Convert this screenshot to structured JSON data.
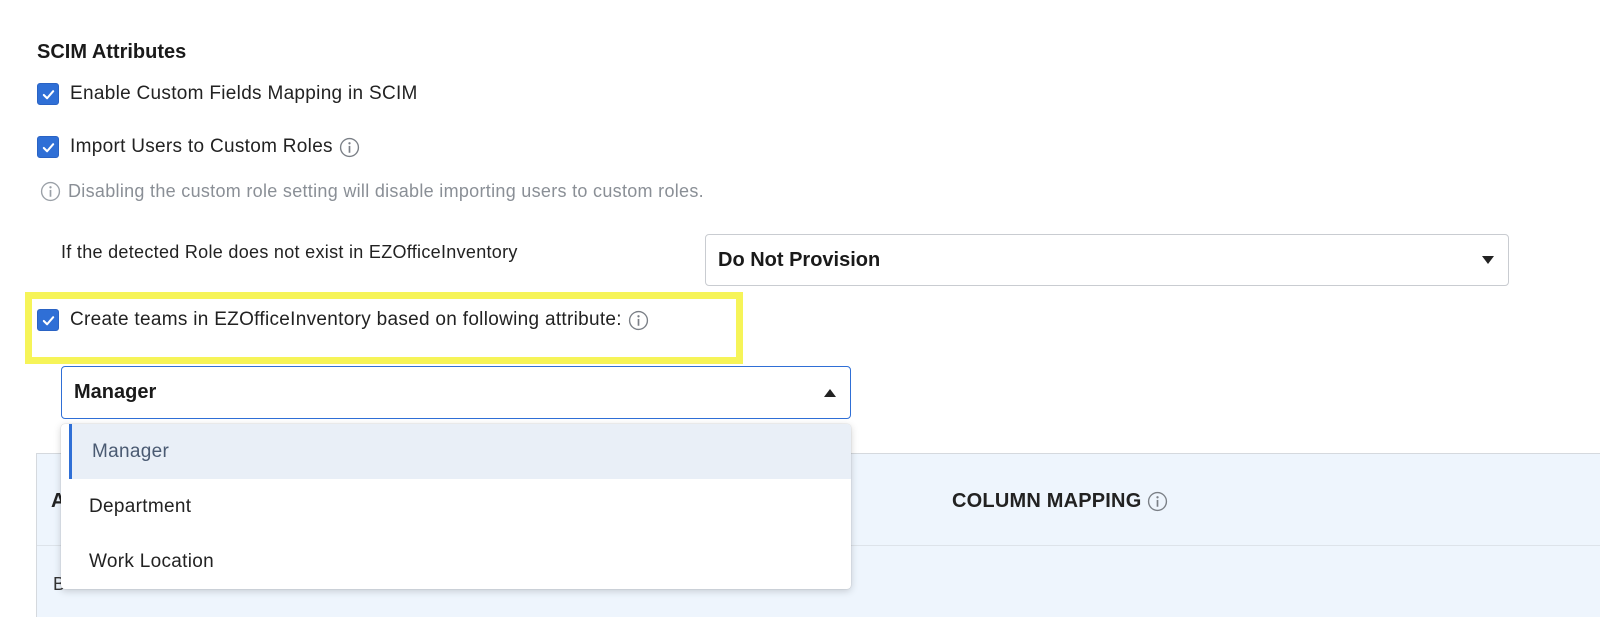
{
  "section": {
    "title": "SCIM Attributes"
  },
  "options": {
    "custom_fields": {
      "label": "Enable Custom Fields Mapping in SCIM",
      "checked": true
    },
    "custom_roles": {
      "label": "Import Users to Custom Roles",
      "checked": true
    },
    "custom_roles_hint": "Disabling the custom role setting will disable importing users to custom roles.",
    "create_teams": {
      "label": "Create teams in EZOfficeInventory based on following attribute:",
      "checked": true
    }
  },
  "role_setting": {
    "label": "If the detected Role does not exist in EZOfficeInventory",
    "value": "Do Not Provision"
  },
  "team_attribute": {
    "value": "Manager",
    "open": true,
    "items": [
      "Manager",
      "Department",
      "Work Location"
    ]
  },
  "table": {
    "header_first": "A",
    "header_mapping": "COLUMN MAPPING",
    "first_cell": "B"
  },
  "colors": {
    "accent": "#2f6fd6",
    "highlight": "#f6f458",
    "table_bg": "#eef5fd"
  }
}
